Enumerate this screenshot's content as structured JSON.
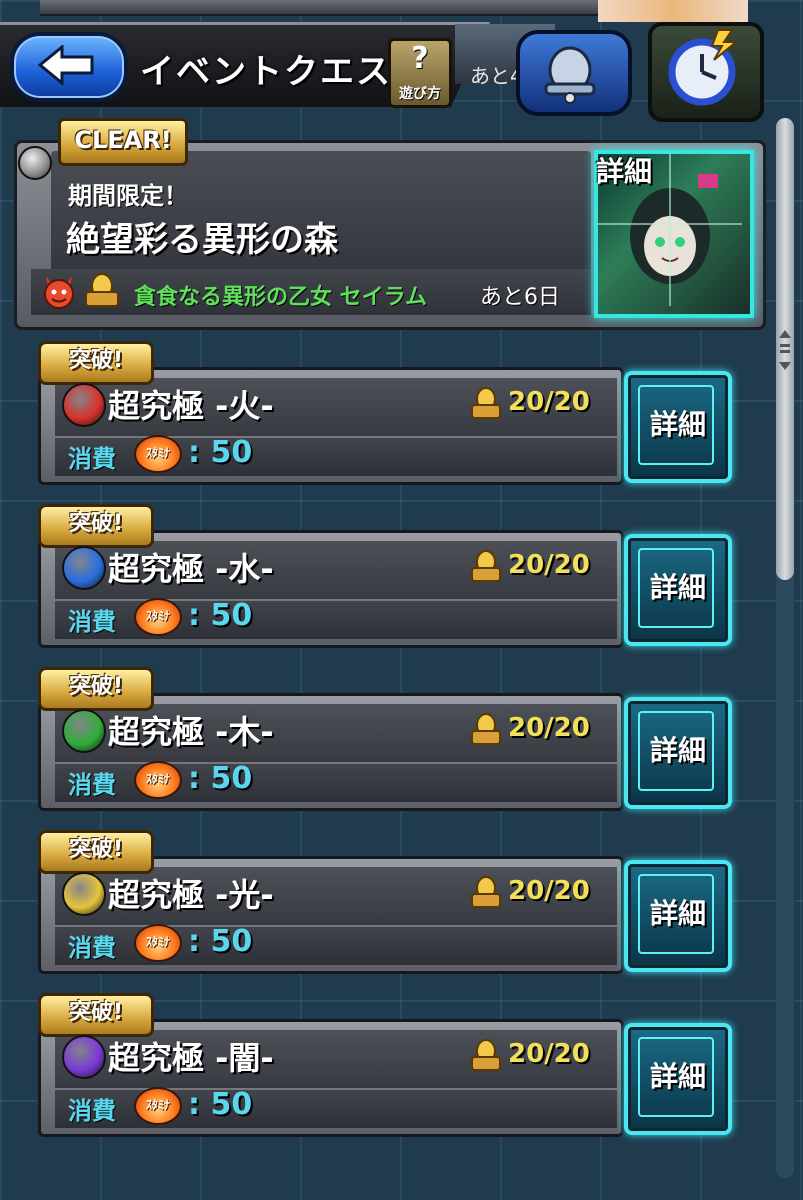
{
  "header": {
    "back_label": "",
    "title": "イベントクエスト",
    "help_symbol": "?",
    "help_label": "遊び方",
    "remain_partial": "あと4"
  },
  "event": {
    "clear_badge": "CLEAR!",
    "subtitle": "期間限定！",
    "title": "絶望彩る異形の森",
    "boss": "貪食なる異形の乙女 セイラム",
    "remaining": "あと6日",
    "detail_label": "詳細"
  },
  "quests": [
    {
      "badge": "突破!",
      "name": "超究極 -火-",
      "count": "20/20",
      "stamina_label": "消費",
      "stamina_icon_text": "ｽﾀﾐﾅ",
      "stamina_value": ": 50",
      "detail_label": "詳細",
      "element": "fire"
    },
    {
      "badge": "突破!",
      "name": "超究極 -水-",
      "count": "20/20",
      "stamina_label": "消費",
      "stamina_icon_text": "ｽﾀﾐﾅ",
      "stamina_value": ": 50",
      "detail_label": "詳細",
      "element": "water"
    },
    {
      "badge": "突破!",
      "name": "超究極 -木-",
      "count": "20/20",
      "stamina_label": "消費",
      "stamina_icon_text": "ｽﾀﾐﾅ",
      "stamina_value": ": 50",
      "detail_label": "詳細",
      "element": "wood"
    },
    {
      "badge": "突破!",
      "name": "超究極 -光-",
      "count": "20/20",
      "stamina_label": "消費",
      "stamina_icon_text": "ｽﾀﾐﾅ",
      "stamina_value": ": 50",
      "detail_label": "詳細",
      "element": "light"
    },
    {
      "badge": "突破!",
      "name": "超究極 -闇-",
      "count": "20/20",
      "stamina_label": "消費",
      "stamina_icon_text": "ｽﾀﾐﾅ",
      "stamina_value": ": 50",
      "detail_label": "詳細",
      "element": "dark"
    }
  ],
  "colors": {
    "fire": "#d9322a",
    "water": "#2a6fe0",
    "wood": "#2fae3a",
    "light": "#e6c43a",
    "dark": "#7a3ad6",
    "accent_cyan": "#4ce6f0",
    "count_yellow": "#f2e05a",
    "stamina_cyan": "#5ad7ee",
    "boss_green": "#5fe05a"
  }
}
